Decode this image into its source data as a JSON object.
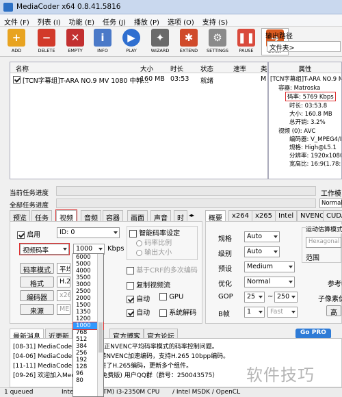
{
  "window": {
    "title": "MediaCoder x64 0.8.41.5816"
  },
  "menu": [
    "文件 (F)",
    "列表 (I)",
    "功能 (E)",
    "任务 (J)",
    "播放 (P)",
    "选项 (O)",
    "支持 (S)"
  ],
  "toolbar": {
    "buttons": [
      {
        "label": "ADD",
        "icon": "add-icon",
        "color": "#e8a320"
      },
      {
        "label": "DELETE",
        "icon": "delete-icon",
        "color": "#d23a2a"
      },
      {
        "label": "EMPTY",
        "icon": "empty-icon",
        "color": "#c23030"
      },
      {
        "label": "INFO",
        "icon": "info-icon",
        "color": "#4a79c8"
      },
      {
        "label": "PLAY",
        "icon": "play-icon",
        "color": "#2f6fd0"
      },
      {
        "label": "WIZARD",
        "icon": "wizard-icon",
        "color": "#6a6a6a"
      },
      {
        "label": "EXTEND",
        "icon": "extend-icon",
        "color": "#d04a2a"
      },
      {
        "label": "SETTINGS",
        "icon": "settings-icon",
        "color": "#8a8a8a"
      },
      {
        "label": "PAUSE",
        "icon": "pause-icon",
        "color": "#d94a3c"
      },
      {
        "label": "START",
        "icon": "start-icon",
        "color": "#d95a20"
      }
    ],
    "output_path_label": "输出路径",
    "output_path_value": "文件夹>"
  },
  "filelist": {
    "columns": [
      "名称",
      "大小",
      "时长",
      "状态",
      "速率",
      "类"
    ],
    "rows": [
      {
        "name": "[TCN字幕组]T-ARA NO.9 MV 1080 中韩...",
        "size": "160 MB",
        "duration": "03:53",
        "status": "就绪",
        "rate": "",
        "type": "M"
      }
    ]
  },
  "properties": {
    "header": "属性",
    "lines": [
      "[TCN字幕组]T-ARA NO.9 M",
      "容器: Matroska",
      "码率: 5769 Kbps",
      "时长: 03:53.8",
      "大小: 160.8 MB",
      "总开销: 3.2%",
      "视频 (0): AVC",
      "编码器: V_MPEG4/I",
      "规格: High@L5.1",
      "分辨率: 1920x1080",
      "宽高比: 16:9(1.78:"
    ]
  },
  "progress": {
    "current_label": "当前任务进度",
    "total_label": "全部任务进度",
    "worktype_label": "工作模",
    "worktype_value": "Normal"
  },
  "left_tabs": [
    "预览",
    "任务",
    "视频",
    "音频",
    "容器",
    "画面",
    "声音",
    "时"
  ],
  "right_tabs": [
    "概要",
    "x264",
    "x265",
    "Intel",
    "NVENC",
    "CUDA"
  ],
  "video": {
    "enable_label": "启用",
    "id_value": "ID: 0",
    "rate_mode_value": "视频码率",
    "bitrate_value": "1000",
    "kbps_label": "Kbps",
    "smart_rate_label": "智能码率设定",
    "rate_ratio_label": "码率比例",
    "output_size_label": "输出大小",
    "crf_label": "基于CRF的多次编码",
    "copy_stream_label": "复制视频流",
    "auto1_label": "自动",
    "gpu_label": "GPU",
    "auto2_label": "自动",
    "sys_decode_label": "系统解码",
    "rate_mode_btn": "码率模式",
    "format_btn": "格式",
    "encoder_btn": "编码器",
    "source_btn": "来源",
    "rate_mode_combo": "平均",
    "format_combo": "H.264",
    "encoder_combo": "x264",
    "source_combo": "MEnc"
  },
  "bitrate_options": [
    "6000",
    "5000",
    "4000",
    "3500",
    "3000",
    "2500",
    "2000",
    "1500",
    "1350",
    "1200",
    "1000",
    "768",
    "512",
    "384",
    "256",
    "192",
    "128",
    "96",
    "80"
  ],
  "bitrate_selected": "1000",
  "x264": {
    "profile_label": "规格",
    "profile_value": "Auto",
    "level_label": "级别",
    "level_value": "Auto",
    "preset_label": "预设",
    "preset_value": "Medium",
    "tune_label": "优化",
    "tune_value": "Normal",
    "gop_label": "GOP",
    "gop_min": "25",
    "gop_sep": "~",
    "gop_max": "250",
    "bframe_label": "B帧",
    "bframe_value": "1",
    "bframe_speed": "Fast",
    "motion_group_label": "运动估算模式",
    "motion_value": "Hexagonal",
    "range_label": "范围",
    "ref_label": "参考帧",
    "subpixel_label": "子像素优",
    "high_label": "高"
  },
  "news": {
    "tabs": [
      "最新消息",
      "近更新",
      "官方博客",
      "官方论坛"
    ],
    "gopro_label": "Go PRO",
    "items": [
      "[08-31] MediaCoder 0.8.41 修正NVENC平均码率模式的码率控制问题。",
      "[04-06] MediaCoder 0.8.3 支持NVENC加速编码，支持H.265 10bpp编码。",
      "[11-11] MediaCoder 0.8.2 改进了H.265编码，更新多个组件。",
      "[09-26] 欢迎加入MediaCoder(免费版) 用户QQ群（群号：250043575）"
    ]
  },
  "status": {
    "queued": "1 queued",
    "cpu": "Intel(R) Core(TM) i3-2350M CPU",
    "msdk": "/ Intel MSDK / OpenCL"
  },
  "watermark": "软件技巧"
}
